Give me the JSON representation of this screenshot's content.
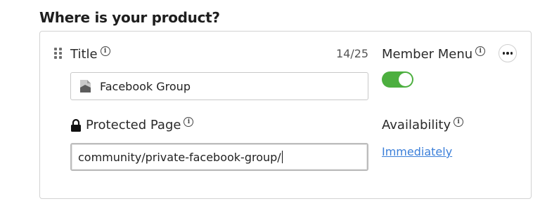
{
  "section": {
    "heading": "Where is your product?"
  },
  "title_field": {
    "label": "Title",
    "char_count": "14/25",
    "value": "Facebook Group",
    "icon": "page-icon"
  },
  "protected_page": {
    "label": "Protected Page",
    "value": "community/private-facebook-group/",
    "icon": "lock-icon"
  },
  "member_menu": {
    "label": "Member Menu",
    "enabled": true,
    "toggle_color": "#4caf3f"
  },
  "availability": {
    "label": "Availability",
    "link_text": "Immediately",
    "link_color": "#3b7fd9"
  },
  "info_glyph": "i"
}
